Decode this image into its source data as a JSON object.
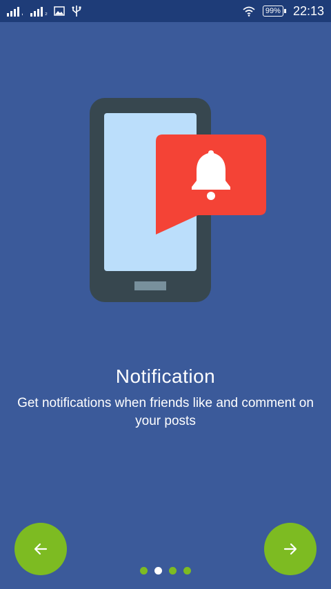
{
  "status_bar": {
    "time": "22:13",
    "battery": "99%",
    "icons": [
      "signal-icon",
      "signal-icon",
      "image-icon",
      "usb-icon",
      "wifi-icon",
      "battery-icon"
    ]
  },
  "slide": {
    "title": "Notification",
    "description": "Get notifications when friends like and comment on your posts"
  },
  "navigation": {
    "prev_icon": "arrow-left-icon",
    "next_icon": "arrow-right-icon",
    "pages": 4,
    "active_page": 2
  },
  "colors": {
    "background": "#3b5a9a",
    "status_bar": "#1e3c78",
    "accent": "#7dbb22",
    "phone_body": "#37474f",
    "phone_screen": "#bbdefb",
    "bubble": "#f44336"
  }
}
